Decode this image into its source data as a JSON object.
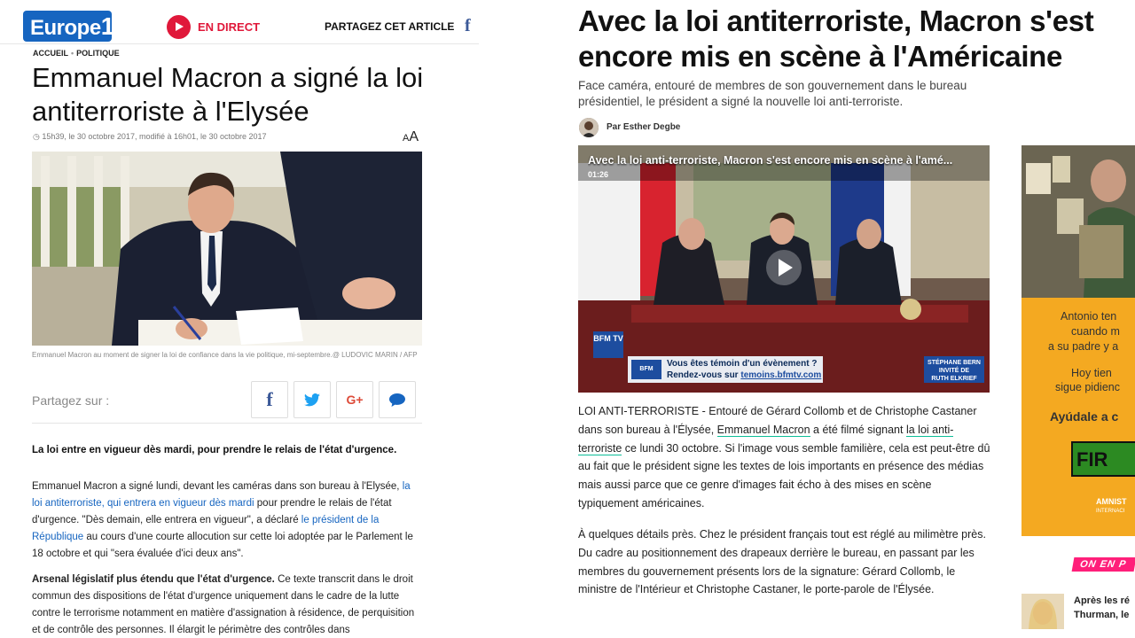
{
  "left": {
    "brand": {
      "name": "Europe",
      "number": "1"
    },
    "header": {
      "live_label": "EN DIRECT",
      "share_label": "PARTAGEZ CET ARTICLE",
      "fb_glyph": "f"
    },
    "breadcrumb": {
      "home": "ACCUEIL",
      "section": "POLITIQUE"
    },
    "title": "Emmanuel Macron a signé la loi antiterroriste à l'Elysée",
    "dateline": "15h39, le 30 octobre 2017, modifié à 16h01, le 30 octobre 2017",
    "font_size_control": {
      "small": "A",
      "large": "A"
    },
    "photo_caption": "Emmanuel Macron au moment de signer la loi de confiance dans la vie politique, mi-septembre.@ LUDOVIC MARIN / AFP",
    "share": {
      "label": "Partagez sur :",
      "buttons": [
        {
          "name": "facebook",
          "glyph": "f",
          "color": "#3b5998"
        },
        {
          "name": "twitter",
          "glyph": "🐦",
          "color": "#1da1f2"
        },
        {
          "name": "google-plus",
          "glyph": "G+",
          "color": "#dd4b39"
        },
        {
          "name": "comments",
          "glyph": "💬",
          "color": "#1665c0"
        }
      ]
    },
    "lead": "La loi entre en vigueur dès mardi, pour prendre le relais de l'état d'urgence.",
    "para1": {
      "t1": "Emmanuel Macron a signé lundi, devant les caméras dans son bureau à l'Elysée, ",
      "link1": "la loi antiterroriste, qui entrera en vigueur dès mardi",
      "t2": " pour prendre le relais de l'état d'urgence. \"Dès demain, elle entrera en vigueur\", a déclaré ",
      "link2": "le président de la République",
      "t3": " au cours d'une courte allocution sur cette loi adoptée par le Parlement le 18 octobre et qui \"sera évaluée d'ici deux ans\"."
    },
    "para2": {
      "bold": "Arsenal législatif plus étendu que l'état d'urgence.",
      "text": " Ce texte transcrit dans le droit commun des dispositions de l'état d'urgence uniquement dans le cadre de la lutte contre le terrorisme notamment en matière d'assignation à résidence, de perquisition et de contrôle des personnes. Il élargit le périmètre des contrôles dans"
    }
  },
  "right": {
    "title": "Avec la loi antiterroriste, Macron s'est encore mis en scène à l'Américaine",
    "subtitle": "Face caméra, entouré de membres de son gouvernement dans le bureau présidentiel, le président a signé la nouvelle loi anti-terroriste.",
    "author": "Par Esther Degbe",
    "video": {
      "title": "Avec la loi anti-terroriste, Macron s'est encore mis en scène à l'amé...",
      "duration": "01:26",
      "channel_logo": "BFM TV",
      "ticker_tag": "BFM",
      "ticker_line1": "Vous êtes témoin d'un évènement ?",
      "ticker_line2_prefix": "Rendez-vous sur ",
      "ticker_line2_link": "temoins.bfmtv.com",
      "guest_line1": "STÉPHANE BERN",
      "guest_line2": "INVITÉ DE",
      "guest_line3": "RUTH ELKRIEF"
    },
    "para1": {
      "t1": "LOI ANTI-TERRORISTE - Entouré de Gérard Collomb et de Christophe Castaner dans son bureau à l'Élysée, ",
      "link1": "Emmanuel Macron",
      "t2": " a été filmé signant ",
      "link2": "la loi anti-terroriste",
      "t3": " ce lundi 30 octobre. Si l'image vous semble familière, cela est peut-être dû au fait que le président signe les textes de lois importants en présence des médias mais aussi parce que ce genre d'images fait écho à des mises en scène typiquement américaines."
    },
    "para2": "À quelques détails près. Chez le président français tout est réglé au milimètre près. Du cadre au positionnement des drapeaux derrière le bureau, en passant par les membres du gouvernement présents lors de la signature: Gérard Collomb, le ministre de l'Intérieur et Christophe Castaner, le porte-parole de l'Élysée.",
    "ad": {
      "line1": "Antonio ten",
      "line2": "cuando m",
      "line3": "a su padre y a",
      "line4": "Hoy tien",
      "line5": "sigue pidienc",
      "line6": "Ayúdale a c",
      "button": "FIR",
      "brand": "AMNIST",
      "brand2": "INTERNACI"
    },
    "on_air": "ON EN P",
    "next_line1": "Après les ré",
    "next_line2": "Thurman, le"
  }
}
